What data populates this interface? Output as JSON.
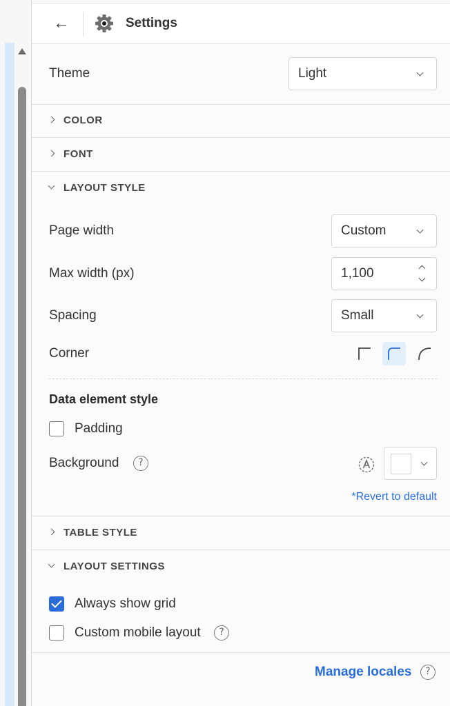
{
  "header": {
    "back_symbol": "←",
    "title": "Settings"
  },
  "theme": {
    "label": "Theme",
    "value": "Light"
  },
  "sections": {
    "color": "COLOR",
    "font": "FONT",
    "layout_style": "LAYOUT STYLE",
    "table_style": "TABLE STYLE",
    "layout_settings": "LAYOUT SETTINGS"
  },
  "layout_style": {
    "page_width_label": "Page width",
    "page_width_value": "Custom",
    "max_width_label": "Max width (px)",
    "max_width_value": "1,100",
    "spacing_label": "Spacing",
    "spacing_value": "Small",
    "corner_label": "Corner",
    "corner_selected": "rounded"
  },
  "data_element_style": {
    "heading": "Data element style",
    "padding_label": "Padding",
    "padding_checked": false,
    "background_label": "Background",
    "background_color": "#ffffff",
    "revert_link": "*Revert to default"
  },
  "layout_settings": {
    "always_show_grid_label": "Always show grid",
    "always_show_grid_checked": true,
    "custom_mobile_label": "Custom mobile layout",
    "custom_mobile_checked": false
  },
  "footer": {
    "manage_locales": "Manage locales"
  },
  "colors": {
    "accent": "#2a6dd9",
    "active_corner_bg": "#e3eefb"
  },
  "icons": {
    "help": "?"
  }
}
